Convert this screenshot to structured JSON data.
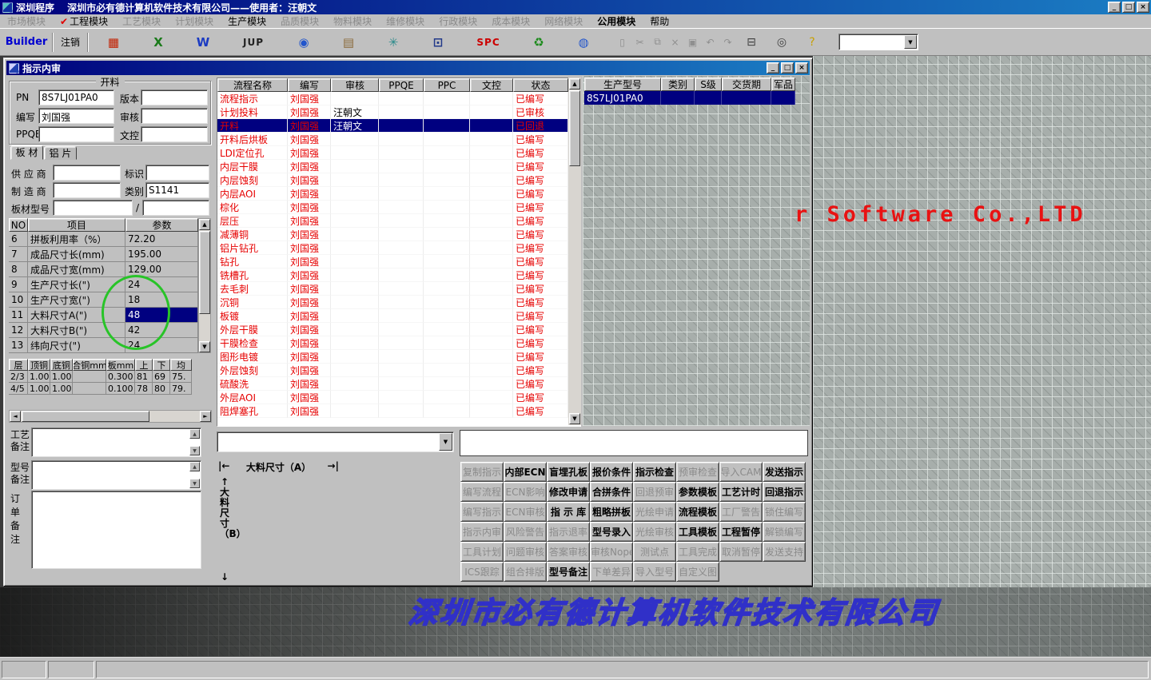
{
  "ui": {
    "arrow_up": "▲",
    "arrow_down": "▼",
    "arrow_left": "◄",
    "arrow_right": "►",
    "dropdown": "▼"
  },
  "titlebar": {
    "title": "深圳程序　 深圳市必有德计算机软件技术有限公司——使用者：汪朝文",
    "minimize": "_",
    "maximize": "□",
    "close": "×"
  },
  "menubar": {
    "check_glyph": "✔",
    "items": [
      {
        "label": "市场模块",
        "enabled": false
      },
      {
        "label": "工程模块",
        "enabled": true,
        "checked": true
      },
      {
        "label": "工艺模块",
        "enabled": false
      },
      {
        "label": "计划模块",
        "enabled": false
      },
      {
        "label": "生产模块",
        "enabled": true
      },
      {
        "label": "品质模块",
        "enabled": false
      },
      {
        "label": "物料模块",
        "enabled": false
      },
      {
        "label": "维修模块",
        "enabled": false
      },
      {
        "label": "行政模块",
        "enabled": false
      },
      {
        "label": "成本模块",
        "enabled": false
      },
      {
        "label": "网络模块",
        "enabled": false
      },
      {
        "label": "公用模块",
        "enabled": true,
        "bold": true
      },
      {
        "label": "帮助",
        "enabled": true
      }
    ]
  },
  "toolbar": {
    "builder_label": "Builder",
    "logout_label": "注销",
    "icons": [
      {
        "name": "report-grid-icon",
        "glyph": "▦",
        "color": "#c22000"
      },
      {
        "name": "excel-icon",
        "glyph": "X",
        "color": "#1a7a1a"
      },
      {
        "name": "word-icon",
        "glyph": "W",
        "color": "#1a3ac2"
      },
      {
        "name": "jup-button",
        "glyph": "JUP",
        "color": "#222222",
        "wide": true
      },
      {
        "name": "preview-eye-icon",
        "glyph": "◉",
        "color": "#2255cc"
      },
      {
        "name": "database-icon",
        "glyph": "▤",
        "color": "#8a6a3a"
      },
      {
        "name": "network-nodes-icon",
        "glyph": "✳",
        "color": "#2a8a8a"
      },
      {
        "name": "workstation-icon",
        "glyph": "⊡",
        "color": "#223a8a"
      },
      {
        "name": "spc-button",
        "glyph": "SPC",
        "color": "#cc0000",
        "wide": true
      },
      {
        "name": "recycle-icon",
        "glyph": "♻",
        "color": "#1a8a1a"
      },
      {
        "name": "globe-icon",
        "glyph": "◍",
        "color": "#2255cc"
      }
    ],
    "small_icons": [
      {
        "name": "new-doc-icon",
        "glyph": "▯"
      },
      {
        "name": "cut-icon",
        "glyph": "✂"
      },
      {
        "name": "copy-icon",
        "glyph": "⧉"
      },
      {
        "name": "delete-icon",
        "glyph": "×"
      },
      {
        "name": "save-icon",
        "glyph": "▣"
      },
      {
        "name": "undo-icon",
        "glyph": "↶"
      },
      {
        "name": "redo-icon",
        "glyph": "↷"
      }
    ],
    "right_icons": [
      {
        "name": "print-icon",
        "glyph": "⊟",
        "color": "#404040"
      },
      {
        "name": "find-icon",
        "glyph": "◎",
        "color": "#404040"
      },
      {
        "name": "help-icon",
        "glyph": "?",
        "color": "#c8a000"
      }
    ],
    "combobox_value": ""
  },
  "child_window": {
    "title": "指示内审",
    "minimize": "_",
    "restore": "□",
    "close": "×",
    "left_panel": {
      "group_title": "开料",
      "header_rows": [
        {
          "l1": "PN",
          "v1": "8S7LJ01PA0",
          "l2": "版本",
          "v2": ""
        },
        {
          "l1": "编写",
          "v1": "刘国强",
          "l2": "审核",
          "v2": ""
        },
        {
          "l1": "PPQE",
          "v1": "",
          "l2": "文控",
          "v2": ""
        }
      ],
      "tabs": [
        "板 材",
        "铝 片"
      ],
      "material_rows": [
        {
          "l1": "供 应 商",
          "v1": "",
          "l2": "标识",
          "v2": ""
        },
        {
          "l1": "制 造 商",
          "v1": "",
          "l2": "类别",
          "v2": "S1141"
        },
        {
          "l1": "板材型号",
          "v1": "",
          "sep": "/",
          "v2": ""
        }
      ],
      "param_table": {
        "headers": [
          "NO",
          "项目",
          "参数"
        ],
        "rows": [
          {
            "no": "6",
            "item": "拼板利用率（%）",
            "value": "72.20",
            "selected": false
          },
          {
            "no": "7",
            "item": "成品尺寸长(mm)",
            "value": "195.00",
            "selected": false
          },
          {
            "no": "8",
            "item": "成品尺寸宽(mm)",
            "value": "129.00",
            "selected": false
          },
          {
            "no": "9",
            "item": "生产尺寸长(\")",
            "value": "24",
            "selected": false
          },
          {
            "no": "10",
            "item": "生产尺寸宽(\")",
            "value": "18",
            "selected": false
          },
          {
            "no": "11",
            "item": "大料尺寸A(\")",
            "value": "48",
            "selected": true
          },
          {
            "no": "12",
            "item": "大料尺寸B(\")",
            "value": "42",
            "selected": false
          },
          {
            "no": "13",
            "item": "纬向尺寸(\")",
            "value": "24",
            "selected": false
          }
        ]
      },
      "layer_table": {
        "headers": [
          "层",
          "顶铜",
          "底铜",
          "合铜mm",
          "板mm",
          "上",
          "下",
          "均"
        ],
        "rows": [
          [
            "2/3",
            "1.00",
            "1.00",
            "",
            "0.300",
            "81",
            "69",
            "75."
          ],
          [
            "4/5",
            "1.00",
            "1.00",
            "",
            "0.100",
            "78",
            "80",
            "79."
          ]
        ]
      },
      "notes": [
        {
          "label": "工艺备注",
          "value": ""
        },
        {
          "label": "型号备注",
          "value": ""
        },
        {
          "label": "订单备注",
          "value": ""
        }
      ]
    },
    "process_table": {
      "headers": [
        "流程名称",
        "编写",
        "审核",
        "PPQE",
        "PPC",
        "文控",
        "状态"
      ],
      "rows": [
        {
          "name": "流程指示",
          "writer": "刘国强",
          "auditor": "",
          "ppqe": "",
          "ppc": "",
          "doc": "",
          "status": "已编写",
          "selected": false
        },
        {
          "name": "计划投料",
          "writer": "刘国强",
          "auditor": "汪朝文",
          "ppqe": "",
          "ppc": "",
          "doc": "",
          "status": "已审核",
          "selected": false
        },
        {
          "name": "开料",
          "writer": "刘国强",
          "auditor": "汪朝文",
          "ppqe": "",
          "ppc": "",
          "doc": "",
          "status": "已回退",
          "selected": true
        },
        {
          "name": "开料后烘板",
          "writer": "刘国强",
          "auditor": "",
          "ppqe": "",
          "ppc": "",
          "doc": "",
          "status": "已编写",
          "selected": false
        },
        {
          "name": "LDI定位孔",
          "writer": "刘国强",
          "auditor": "",
          "ppqe": "",
          "ppc": "",
          "doc": "",
          "status": "已编写",
          "selected": false
        },
        {
          "name": "内层干膜",
          "writer": "刘国强",
          "auditor": "",
          "ppqe": "",
          "ppc": "",
          "doc": "",
          "status": "已编写",
          "selected": false
        },
        {
          "name": "内层蚀刻",
          "writer": "刘国强",
          "auditor": "",
          "ppqe": "",
          "ppc": "",
          "doc": "",
          "status": "已编写",
          "selected": false
        },
        {
          "name": "内层AOI",
          "writer": "刘国强",
          "auditor": "",
          "ppqe": "",
          "ppc": "",
          "doc": "",
          "status": "已编写",
          "selected": false
        },
        {
          "name": "棕化",
          "writer": "刘国强",
          "auditor": "",
          "ppqe": "",
          "ppc": "",
          "doc": "",
          "status": "已编写",
          "selected": false
        },
        {
          "name": "层压",
          "writer": "刘国强",
          "auditor": "",
          "ppqe": "",
          "ppc": "",
          "doc": "",
          "status": "已编写",
          "selected": false
        },
        {
          "name": "减薄铜",
          "writer": "刘国强",
          "auditor": "",
          "ppqe": "",
          "ppc": "",
          "doc": "",
          "status": "已编写",
          "selected": false
        },
        {
          "name": "铝片钻孔",
          "writer": "刘国强",
          "auditor": "",
          "ppqe": "",
          "ppc": "",
          "doc": "",
          "status": "已编写",
          "selected": false
        },
        {
          "name": "钻孔",
          "writer": "刘国强",
          "auditor": "",
          "ppqe": "",
          "ppc": "",
          "doc": "",
          "status": "已编写",
          "selected": false
        },
        {
          "name": "铣槽孔",
          "writer": "刘国强",
          "auditor": "",
          "ppqe": "",
          "ppc": "",
          "doc": "",
          "status": "已编写",
          "selected": false
        },
        {
          "name": "去毛刺",
          "writer": "刘国强",
          "auditor": "",
          "ppqe": "",
          "ppc": "",
          "doc": "",
          "status": "已编写",
          "selected": false
        },
        {
          "name": "沉铜",
          "writer": "刘国强",
          "auditor": "",
          "ppqe": "",
          "ppc": "",
          "doc": "",
          "status": "已编写",
          "selected": false
        },
        {
          "name": "板镀",
          "writer": "刘国强",
          "auditor": "",
          "ppqe": "",
          "ppc": "",
          "doc": "",
          "status": "已编写",
          "selected": false
        },
        {
          "name": "外层干膜",
          "writer": "刘国强",
          "auditor": "",
          "ppqe": "",
          "ppc": "",
          "doc": "",
          "status": "已编写",
          "selected": false
        },
        {
          "name": "干膜检查",
          "writer": "刘国强",
          "auditor": "",
          "ppqe": "",
          "ppc": "",
          "doc": "",
          "status": "已编写",
          "selected": false
        },
        {
          "name": "图形电镀",
          "writer": "刘国强",
          "auditor": "",
          "ppqe": "",
          "ppc": "",
          "doc": "",
          "status": "已编写",
          "selected": false
        },
        {
          "name": "外层蚀刻",
          "writer": "刘国强",
          "auditor": "",
          "ppqe": "",
          "ppc": "",
          "doc": "",
          "status": "已编写",
          "selected": false
        },
        {
          "name": "硫酸洗",
          "writer": "刘国强",
          "auditor": "",
          "ppqe": "",
          "ppc": "",
          "doc": "",
          "status": "已编写",
          "selected": false
        },
        {
          "name": "外层AOI",
          "writer": "刘国强",
          "auditor": "",
          "ppqe": "",
          "ppc": "",
          "doc": "",
          "status": "已编写",
          "selected": false
        },
        {
          "name": "阻焊塞孔",
          "writer": "刘国强",
          "auditor": "",
          "ppqe": "",
          "ppc": "",
          "doc": "",
          "status": "已编写",
          "selected": false
        }
      ]
    },
    "model_table": {
      "headers": [
        "生产型号",
        "类别",
        "S级",
        "交货期",
        "军品"
      ],
      "rows": [
        {
          "model": "8S7LJ01PA0",
          "category": "",
          "s_level": "",
          "delivery": "",
          "military": "",
          "selected": true
        }
      ]
    },
    "bottom": {
      "combo_value": "",
      "textbox_value": ""
    },
    "diagram": {
      "h_left": "|←",
      "h_label": "大料尺寸（A）",
      "h_right": "→|",
      "v_top": "↑",
      "v_label": "大料尺寸（B）",
      "v_bottom": "↓"
    },
    "action_buttons": [
      [
        {
          "label": "复制指示",
          "enabled": false
        },
        {
          "label": "内部ECN",
          "enabled": true
        },
        {
          "label": "盲埋孔板",
          "enabled": true
        },
        {
          "label": "报价条件",
          "enabled": true
        },
        {
          "label": "指示检查",
          "enabled": true
        },
        {
          "label": "预审检查",
          "enabled": false
        },
        {
          "label": "导入CAM",
          "enabled": false
        },
        {
          "label": "发送指示",
          "enabled": true
        }
      ],
      [
        {
          "label": "编写流程",
          "enabled": false
        },
        {
          "label": "ECN影响",
          "enabled": false
        },
        {
          "label": "修改申请",
          "enabled": true
        },
        {
          "label": "合拼条件",
          "enabled": true
        },
        {
          "label": "回退预审",
          "enabled": false
        },
        {
          "label": "参数模板",
          "enabled": true
        },
        {
          "label": "工艺计时",
          "enabled": true
        },
        {
          "label": "回退指示",
          "enabled": true
        }
      ],
      [
        {
          "label": "编写指示",
          "enabled": false
        },
        {
          "label": "ECN审核",
          "enabled": false
        },
        {
          "label": "指 示 库",
          "enabled": true
        },
        {
          "label": "粗略拼板",
          "enabled": true
        },
        {
          "label": "光绘申请",
          "enabled": false
        },
        {
          "label": "流程模板",
          "enabled": true
        },
        {
          "label": "工厂警告",
          "enabled": false
        },
        {
          "label": "锁住编写",
          "enabled": false
        }
      ],
      [
        {
          "label": "指示内审",
          "enabled": false
        },
        {
          "label": "风险警告",
          "enabled": false
        },
        {
          "label": "指示退率",
          "enabled": false
        },
        {
          "label": "型号录入",
          "enabled": true
        },
        {
          "label": "光绘审核",
          "enabled": false
        },
        {
          "label": "工具模板",
          "enabled": true
        },
        {
          "label": "工程暂停",
          "enabled": true
        },
        {
          "label": "解锁编写",
          "enabled": false
        }
      ],
      [
        {
          "label": "工具计划",
          "enabled": false
        },
        {
          "label": "问题审核",
          "enabled": false
        },
        {
          "label": "答案审核",
          "enabled": false
        },
        {
          "label": "审核Nope",
          "enabled": false
        },
        {
          "label": "测试点",
          "enabled": false
        },
        {
          "label": "工具完成",
          "enabled": false
        },
        {
          "label": "取消暂停",
          "enabled": false
        },
        {
          "label": "发送支持",
          "enabled": false
        }
      ],
      [
        {
          "label": "ICS跟踪",
          "enabled": false
        },
        {
          "label": "组合排版",
          "enabled": false
        },
        {
          "label": "型号备注",
          "enabled": true
        },
        {
          "label": "下单差异",
          "enabled": false
        },
        {
          "label": "导入型号",
          "enabled": false
        },
        {
          "label": "自定义图",
          "enabled": false
        }
      ]
    ]
  },
  "watermark": "r Software Co.,LTD",
  "banner": "深圳市必有德计算机软件技术有限公司",
  "statusbar": {
    "panels": [
      "",
      "",
      ""
    ]
  }
}
